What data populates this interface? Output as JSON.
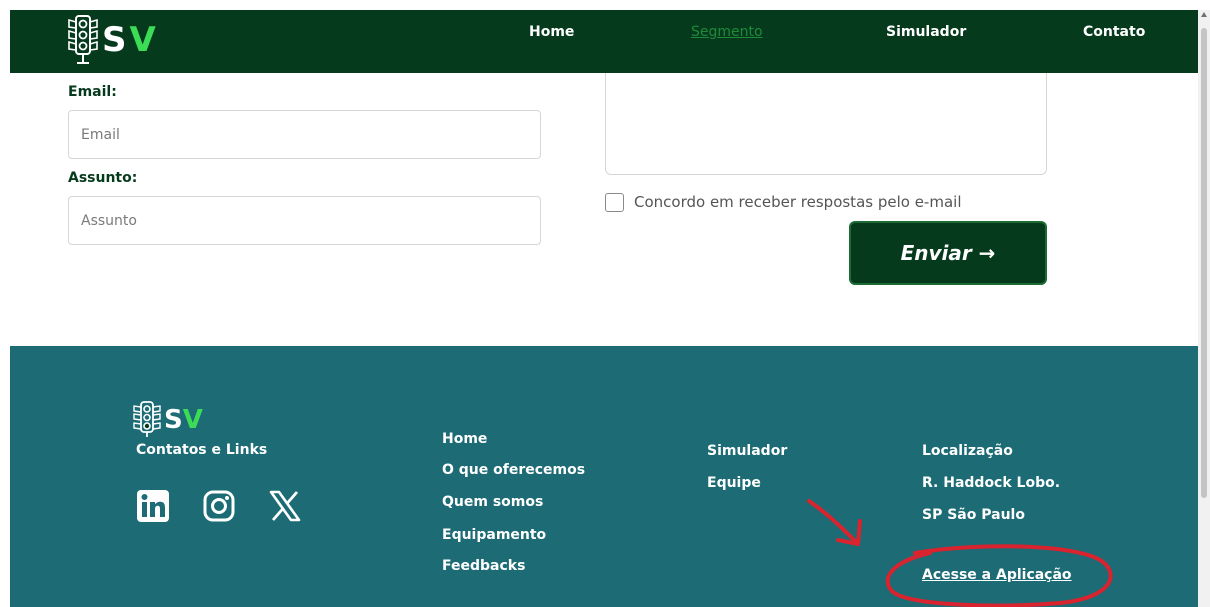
{
  "brand": {
    "logo_text_left": "S",
    "logo_text_right": "V",
    "colors": {
      "dark_green": "#063a1d",
      "bright_green": "#3ddc56",
      "teal": "#1c6b75",
      "annotation_red": "#d9232e"
    }
  },
  "nav": {
    "links": [
      "Home",
      "Segmento",
      "Simulador",
      "Contato"
    ],
    "active": "Segmento"
  },
  "form": {
    "email_label": "Email:",
    "email_placeholder": "Email",
    "subject_label": "Assunto:",
    "subject_placeholder": "Assunto",
    "consent_label": "Concordo em receber respostas pelo e-mail",
    "consent_checked": false,
    "submit_label": "Enviar →"
  },
  "footer": {
    "contacts_title": "Contatos e Links",
    "social_icons": [
      "linkedin-icon",
      "instagram-icon",
      "x-icon"
    ],
    "col1": [
      "Home",
      "O que oferecemos",
      "Quem somos",
      "Equipamento",
      "Feedbacks"
    ],
    "col2": [
      "Simulador",
      "Equipe"
    ],
    "location_title": "Localização",
    "address_line1": "R. Haddock Lobo.",
    "address_line2": "SP São Paulo",
    "app_link": "Acesse a Aplicação"
  }
}
